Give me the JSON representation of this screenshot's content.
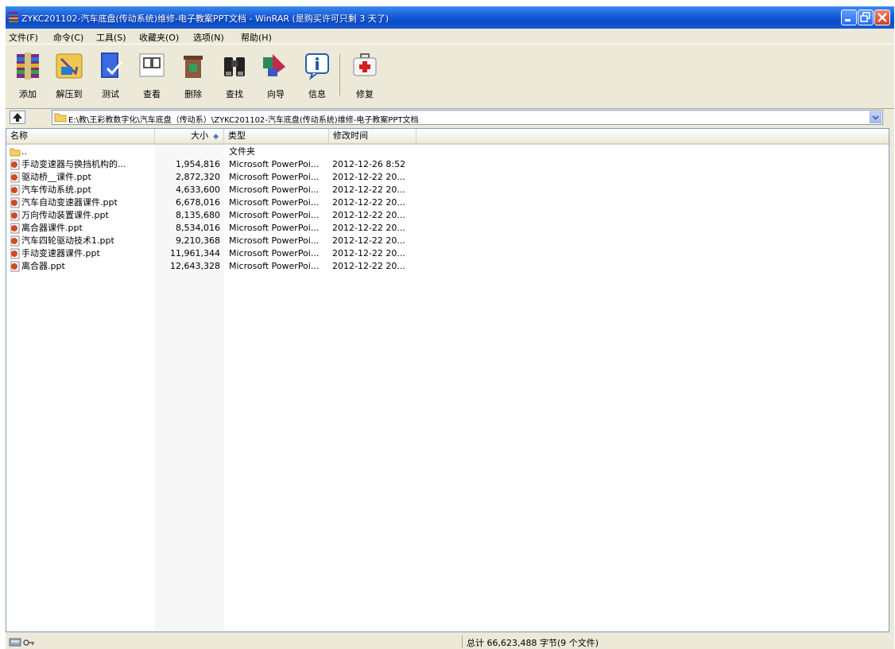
{
  "window": {
    "title": "ZYKC201102-汽车底盘(传动系统)维修-电子教案PPT文档 - WinRAR (是购买许可只剩 3 天了)"
  },
  "menu": [
    {
      "name": "menu-file",
      "label": "文件(F)"
    },
    {
      "name": "menu-commands",
      "label": "命令(C)"
    },
    {
      "name": "menu-tools",
      "label": "工具(S)"
    },
    {
      "name": "menu-favorites",
      "label": "收藏夹(O)"
    },
    {
      "name": "menu-options",
      "label": "选项(N)"
    },
    {
      "name": "menu-help",
      "label": "帮助(H)"
    }
  ],
  "toolbar": {
    "add": "添加",
    "extract": "解压到",
    "test": "测试",
    "view": "查看",
    "delete": "删除",
    "find": "查找",
    "wizard": "向导",
    "info": "信息",
    "repair": "修复"
  },
  "address": {
    "path": "E:\\教\\王彩教数字化\\汽车底盘（传动系）\\ZYKC201102-汽车底盘(传动系统)维修-电子教案PPT文档"
  },
  "columns": {
    "name": "名称",
    "size": "大小",
    "type": "类型",
    "modified": "修改时间"
  },
  "files": [
    {
      "name": "..",
      "size": "",
      "type": "文件夹",
      "modified": ""
    },
    {
      "name": "手动变速器与换挡机构的...",
      "size": "1,954,816",
      "type": "Microsoft PowerPoi...",
      "modified": "2012-12-26 8:52"
    },
    {
      "name": "驱动桥__课件.ppt",
      "size": "2,872,320",
      "type": "Microsoft PowerPoi...",
      "modified": "2012-12-22 20..."
    },
    {
      "name": "汽车传动系统.ppt",
      "size": "4,633,600",
      "type": "Microsoft PowerPoi...",
      "modified": "2012-12-22 20..."
    },
    {
      "name": "汽车自动变速器课件.ppt",
      "size": "6,678,016",
      "type": "Microsoft PowerPoi...",
      "modified": "2012-12-22 20..."
    },
    {
      "name": "万向传动装置课件.ppt",
      "size": "8,135,680",
      "type": "Microsoft PowerPoi...",
      "modified": "2012-12-22 20..."
    },
    {
      "name": "离合器课件.ppt",
      "size": "8,534,016",
      "type": "Microsoft PowerPoi...",
      "modified": "2012-12-22 20..."
    },
    {
      "name": "汽车四轮驱动技术1.ppt",
      "size": "9,210,368",
      "type": "Microsoft PowerPoi...",
      "modified": "2012-12-22 20..."
    },
    {
      "name": "手动变速器课件.ppt",
      "size": "11,961,344",
      "type": "Microsoft PowerPoi...",
      "modified": "2012-12-22 20..."
    },
    {
      "name": "离合器.ppt",
      "size": "12,643,328",
      "type": "Microsoft PowerPoi...",
      "modified": "2012-12-22 20..."
    }
  ],
  "status": {
    "text": "总计 66,623,488 字节(9 个文件)"
  }
}
